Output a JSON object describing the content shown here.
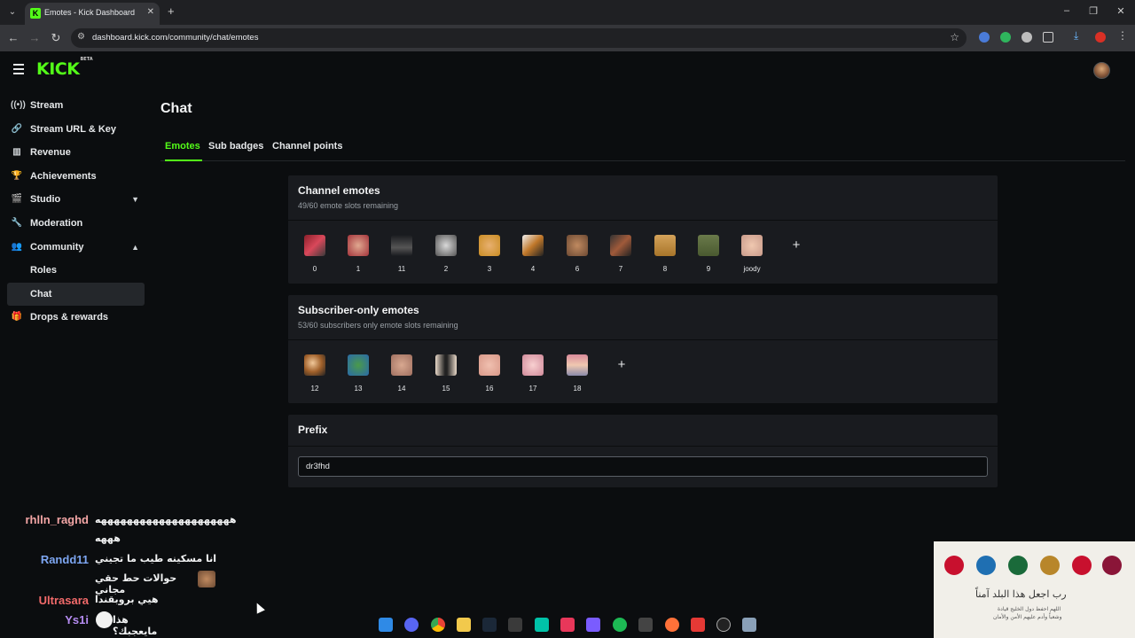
{
  "browser": {
    "tab_title": "Emotes - Kick Dashboard",
    "url": "dashboard.kick.com/community/chat/emotes"
  },
  "brand": {
    "logo": "KICK",
    "beta": "BETA",
    "accent": "#53fc18"
  },
  "sidebar": {
    "items": [
      {
        "label": "Stream",
        "icon": "broadcast-icon"
      },
      {
        "label": "Stream URL & Key",
        "icon": "link-icon"
      },
      {
        "label": "Revenue",
        "icon": "chart-icon"
      },
      {
        "label": "Achievements",
        "icon": "trophy-icon"
      },
      {
        "label": "Studio",
        "icon": "clapperboard-icon",
        "expandable": "collapsed"
      },
      {
        "label": "Moderation",
        "icon": "wrench-icon"
      },
      {
        "label": "Community",
        "icon": "people-icon",
        "expandable": "expanded"
      },
      {
        "label": "Roles",
        "sub": true
      },
      {
        "label": "Chat",
        "sub": true,
        "active": true
      },
      {
        "label": "Drops & rewards",
        "icon": "gift-icon"
      }
    ]
  },
  "page": {
    "title": "Chat",
    "tabs": [
      "Emotes",
      "Sub badges",
      "Channel points"
    ],
    "active_tab": "Emotes"
  },
  "channel_emotes": {
    "title": "Channel emotes",
    "subtitle": "49/60 emote slots remaining",
    "emotes": [
      "0",
      "1",
      "11",
      "2",
      "3",
      "4",
      "6",
      "7",
      "8",
      "9",
      "joody"
    ],
    "add_label": "+"
  },
  "subscriber_emotes": {
    "title": "Subscriber-only emotes",
    "subtitle": "53/60 subscribers only emote slots remaining",
    "emotes": [
      "12",
      "13",
      "14",
      "15",
      "16",
      "17",
      "18"
    ],
    "add_label": "+"
  },
  "prefix": {
    "title": "Prefix",
    "value": "dr3fhd"
  },
  "chat_overlay": [
    {
      "user": "rhlln_raghd",
      "color": "#f4a6a6",
      "message": "هههههههههههههههههههههه"
    },
    {
      "user": "",
      "color": "#f4a6a6",
      "message": "هههه"
    },
    {
      "user": "Randd11",
      "color": "#7da6f2",
      "message": "انا مسكينه طيب ما تجيني"
    },
    {
      "user": "",
      "color": "#7da6f2",
      "message": "حوالات حط حقي مجاني"
    },
    {
      "user": "Ultrasara",
      "color": "#f26a6a",
      "message": "هيي بروبقندا"
    },
    {
      "user": "Ys1i",
      "color": "#b68cf2",
      "message": "هذا مايعجبك؟"
    }
  ],
  "overlay_card": {
    "text": "رب اجعل هذا البلد آمناً",
    "small_1": "اللهم احفظ دول الخليج قيادة",
    "small_2": "وشعباً وأدم عليهم الأمن والأمان"
  }
}
